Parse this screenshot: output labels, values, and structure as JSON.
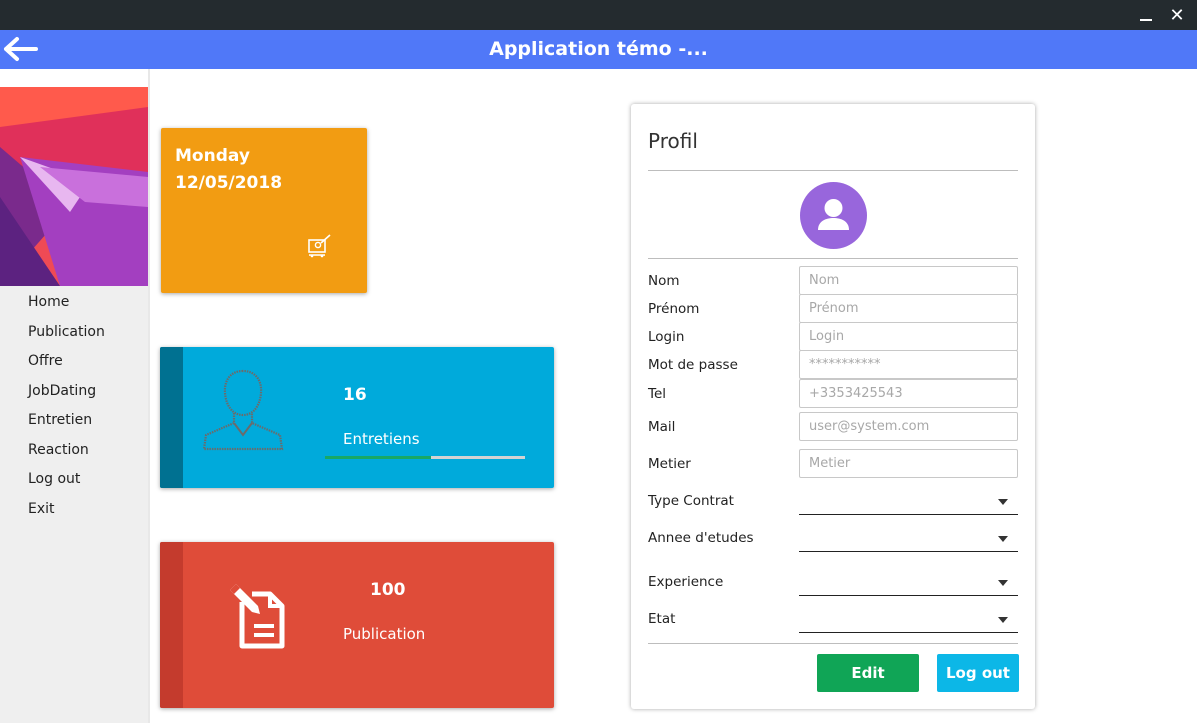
{
  "window": {
    "minimize_icon": "minimize-icon",
    "close_icon": "close-icon",
    "close_glyph": "✕"
  },
  "appbar": {
    "title": "Application témo -...",
    "back_icon": "back-arrow-icon"
  },
  "sidebar": {
    "items": [
      {
        "label": "Home"
      },
      {
        "label": "Publication"
      },
      {
        "label": "Offre"
      },
      {
        "label": "JobDating"
      },
      {
        "label": "Entretien"
      },
      {
        "label": "Reaction"
      },
      {
        "label": "Log out"
      },
      {
        "label": "Exit"
      }
    ]
  },
  "date_card": {
    "day": "Monday",
    "date": "12/05/2018",
    "icon": "calendar-edit-icon",
    "color": "#f29c12"
  },
  "entretiens_card": {
    "count": "16",
    "label": "Entretiens",
    "icon": "person-outline-icon",
    "progress": 0.53,
    "color": "#00aadb"
  },
  "publication_card": {
    "count": "100",
    "label": "Publication",
    "icon": "document-edit-icon",
    "color": "#df4c39"
  },
  "profil": {
    "title": "Profil",
    "avatar_icon": "user-avatar-icon",
    "fields": {
      "nom": {
        "label": "Nom",
        "placeholder": "Nom"
      },
      "prenom": {
        "label": "Prénom",
        "placeholder": "Prénom"
      },
      "login": {
        "label": "Login",
        "placeholder": "Login"
      },
      "password": {
        "label": "Mot de passe",
        "placeholder": "***********"
      },
      "tel": {
        "label": "Tel",
        "placeholder": "+3353425543"
      },
      "mail": {
        "label": "Mail",
        "placeholder": "user@system.com"
      },
      "metier": {
        "label": "Metier",
        "placeholder": "Metier"
      }
    },
    "combos": {
      "type_contrat": {
        "label": "Type Contrat",
        "value": ""
      },
      "annee_etudes": {
        "label": "Annee d'etudes",
        "value": ""
      },
      "experience": {
        "label": "Experience",
        "value": ""
      },
      "etat": {
        "label": "Etat",
        "value": ""
      }
    },
    "edit_label": "Edit",
    "logout_label": "Log out"
  }
}
